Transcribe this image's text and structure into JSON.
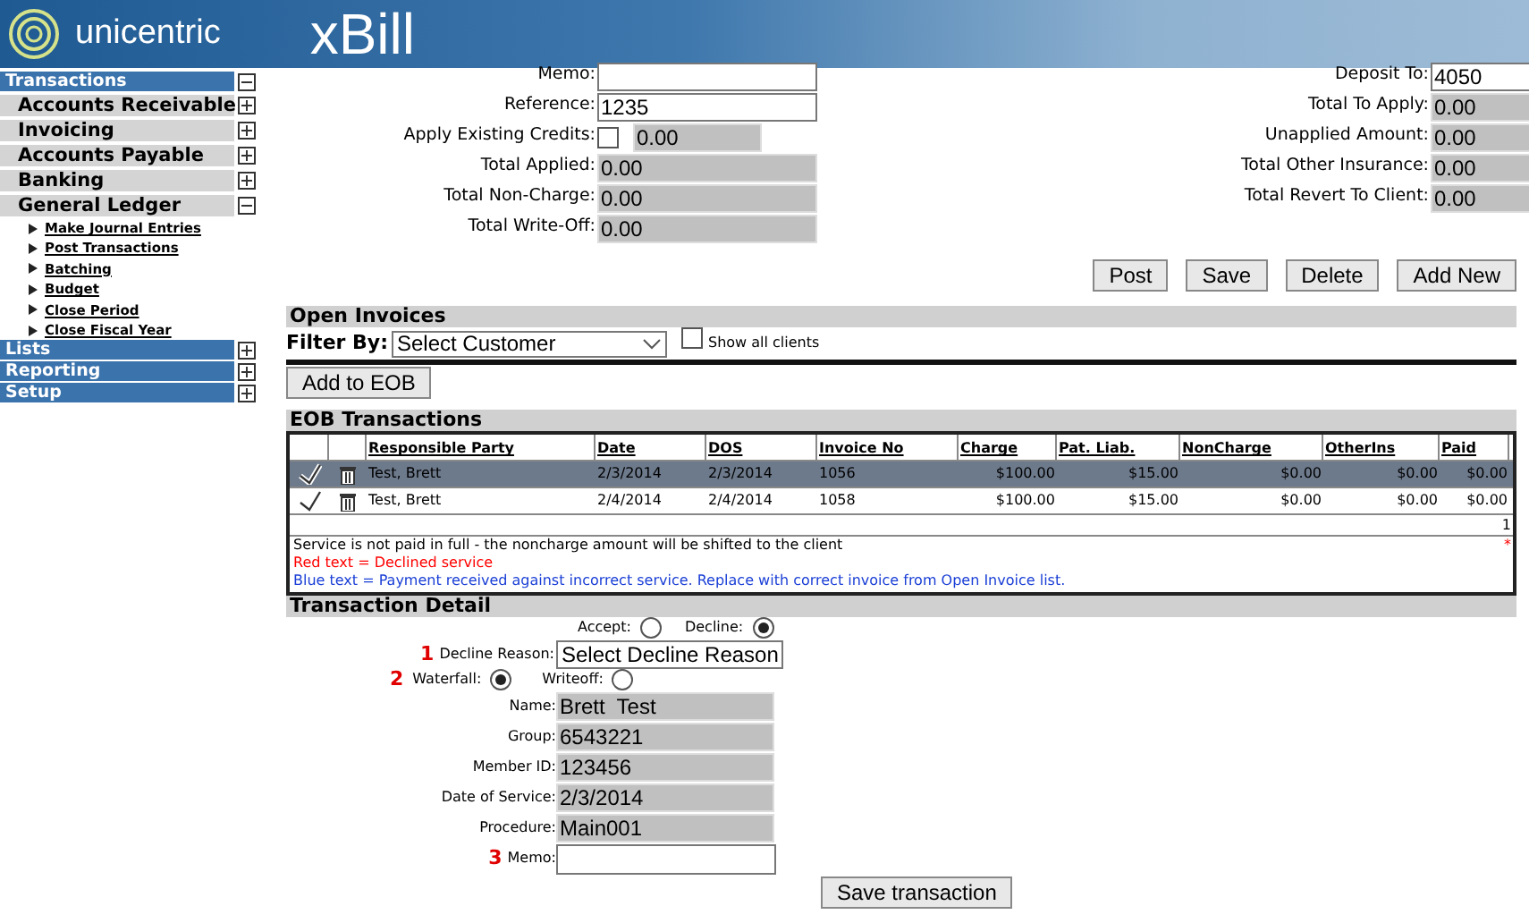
{
  "header": {
    "logo": "unicentric",
    "app": "xBill"
  },
  "sidebar": [
    {
      "label": "Transactions",
      "expanded": true,
      "children": [
        {
          "label": "Accounts Receivable",
          "expanded": false
        },
        {
          "label": "Invoicing",
          "expanded": false
        },
        {
          "label": "Accounts Payable",
          "expanded": false
        },
        {
          "label": "Banking",
          "expanded": false
        },
        {
          "label": "General Ledger",
          "expanded": true,
          "children": [
            {
              "label": "Make Journal Entries"
            },
            {
              "label": "Post Transactions"
            },
            {
              "label": "Batching"
            },
            {
              "label": "Budget"
            },
            {
              "label": "Close Period"
            },
            {
              "label": "Close Fiscal Year"
            }
          ]
        }
      ]
    },
    {
      "label": "Lists",
      "expanded": false
    },
    {
      "label": "Reporting",
      "expanded": false
    },
    {
      "label": "Setup",
      "expanded": false
    }
  ],
  "form_left": [
    {
      "label": "Memo:",
      "kind": "input"
    },
    {
      "label": "Reference:",
      "kind": "input",
      "value": "1235"
    },
    {
      "label": "Apply Existing Credits:",
      "kind": "credits",
      "checked": false,
      "value": "0.00"
    },
    {
      "label": "Total Applied:",
      "kind": "readonly",
      "value": "0.00"
    },
    {
      "label": "Total Non-Charge:",
      "kind": "readonly",
      "value": "0.00"
    },
    {
      "label": "Total Write-Off:",
      "kind": "readonly",
      "value": "0.00"
    }
  ],
  "form_right": [
    {
      "label": "Deposit To:",
      "kind": "input",
      "value": "4050"
    },
    {
      "label": "Total To Apply:",
      "kind": "readonly",
      "value": "0.00"
    },
    {
      "label": "Unapplied Amount:",
      "kind": "readonly",
      "value": "0.00"
    },
    {
      "label": "Total Other Insurance:",
      "kind": "readonly",
      "value": "0.00"
    },
    {
      "label": "Total Revert To Client:",
      "kind": "readonly",
      "value": "0.00"
    }
  ],
  "buttons": [
    "Post",
    "Save",
    "Delete",
    "Add New"
  ],
  "open_invoices": {
    "title": "Open Invoices",
    "filter_label": "Filter By:",
    "filter_value": "Select Customer",
    "show_all": {
      "label": "Show all clients",
      "checked": false
    },
    "add_button": "Add to EOB"
  },
  "eob": {
    "title": "EOB Transactions",
    "columns": [
      "Responsible Party",
      "Date",
      "DOS",
      "Invoice No",
      "Charge",
      "Pat. Liab.",
      "NonCharge",
      "OtherIns",
      "Paid"
    ],
    "rows": [
      {
        "selected": true,
        "cells": [
          "Test, Brett",
          "2/3/2014",
          "2/3/2014",
          "1056",
          "$100.00",
          "$15.00",
          "$0.00",
          "$0.00",
          "$0.00"
        ]
      },
      {
        "selected": false,
        "cells": [
          "Test, Brett",
          "2/4/2014",
          "2/4/2014",
          "1058",
          "$100.00",
          "$15.00",
          "$0.00",
          "$0.00",
          "$0.00"
        ]
      }
    ],
    "page": "1",
    "mark": "*",
    "notes": [
      {
        "text": "Service is not paid in full - the noncharge amount will be shifted to the client",
        "color": "#000000"
      },
      {
        "text": "Red text = Declined service",
        "color": "#ff0000"
      },
      {
        "text": "Blue text = Payment received against incorrect service. Replace with correct invoice from Open Invoice list.",
        "color": "#1a3fd6"
      }
    ]
  },
  "detail": {
    "title": "Transaction Detail",
    "status": [
      {
        "label": "Accept:",
        "selected": false
      },
      {
        "label": "Decline:",
        "selected": true
      }
    ],
    "reason": {
      "step": "1",
      "label": "Decline Reason:",
      "value": "Select Decline Reason"
    },
    "method_step": "2",
    "method": [
      {
        "label": "Waterfall:",
        "selected": true
      },
      {
        "label": "Writeoff:",
        "selected": false
      }
    ],
    "fields": [
      {
        "label": "Name:",
        "value": "Brett  Test"
      },
      {
        "label": "Group:",
        "value": "6543221"
      },
      {
        "label": "Member ID:",
        "value": "123456"
      },
      {
        "label": "Date of Service:",
        "value": "2/3/2014"
      },
      {
        "label": "Procedure:",
        "value": "Main001"
      }
    ],
    "memo": {
      "step": "3",
      "label": "Memo:"
    },
    "save_button": "Save transaction"
  }
}
